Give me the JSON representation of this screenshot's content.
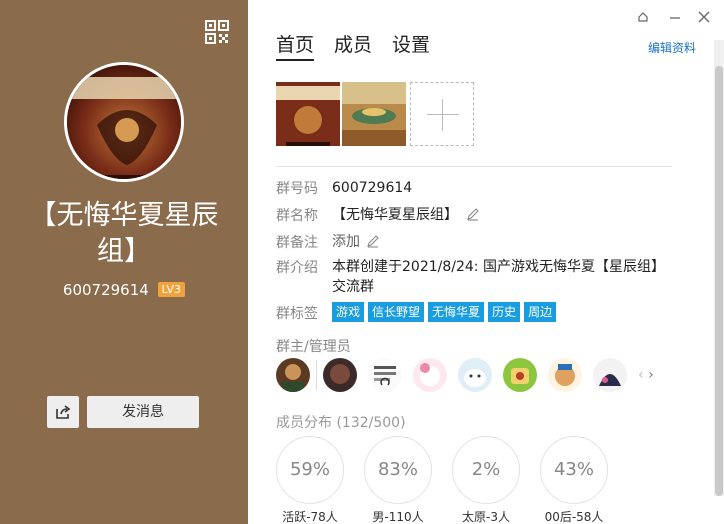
{
  "group": {
    "name": "【无悔华夏星辰组】",
    "id": "600729614",
    "level": "LV3",
    "send_button": "发消息"
  },
  "tabs": [
    "首页",
    "成员",
    "设置"
  ],
  "edit_profile": "编辑资料",
  "info": {
    "id_label": "群号码",
    "id_value": "600729614",
    "name_label": "群名称",
    "name_value": "【无悔华夏星辰组】",
    "remark_label": "群备注",
    "remark_value": "添加",
    "intro_label": "群介绍",
    "intro_value": "本群创建于2021/8/24: 国产游戏无悔华夏【星辰组】交流群",
    "tags_label": "群标签",
    "tags": [
      "游戏",
      "信长野望",
      "无悔华夏",
      "历史",
      "周边"
    ],
    "admins_label": "群主/管理员"
  },
  "distribution": {
    "title": "成员分布",
    "count": "(132/500)",
    "items": [
      {
        "pct": "59%",
        "label": "活跃-78人"
      },
      {
        "pct": "83%",
        "label": "男-110人"
      },
      {
        "pct": "2%",
        "label": "太原-3人"
      },
      {
        "pct": "43%",
        "label": "00后-58人"
      }
    ]
  },
  "colors": {
    "left_panel": "#8a6c4d",
    "tag_blue": "#1a9de0",
    "level_badge": "#f0a33b",
    "link": "#1a73c8"
  }
}
